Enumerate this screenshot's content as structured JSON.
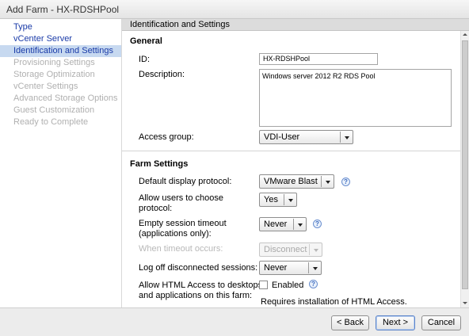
{
  "window": {
    "title": "Add Farm - HX-RDSHPool"
  },
  "sidebar": {
    "items": [
      {
        "label": "Type",
        "state": "done"
      },
      {
        "label": "vCenter Server",
        "state": "done"
      },
      {
        "label": "Identification and Settings",
        "state": "active"
      },
      {
        "label": "Provisioning Settings",
        "state": "disabled"
      },
      {
        "label": "Storage Optimization",
        "state": "disabled"
      },
      {
        "label": "vCenter Settings",
        "state": "disabled"
      },
      {
        "label": "Advanced Storage Options",
        "state": "disabled"
      },
      {
        "label": "Guest Customization",
        "state": "disabled"
      },
      {
        "label": "Ready to Complete",
        "state": "disabled"
      }
    ]
  },
  "main": {
    "header": "Identification and Settings",
    "general": {
      "title": "General",
      "id_label": "ID:",
      "id_value": "HX-RDSHPool",
      "description_label": "Description:",
      "description_value": "Windows server 2012 R2 RDS Pool",
      "access_group_label": "Access group:",
      "access_group_value": "VDI-User"
    },
    "farm_settings": {
      "title": "Farm Settings",
      "display_protocol_label": "Default display protocol:",
      "display_protocol_value": "VMware Blast",
      "allow_choose_label_1": "Allow users to choose",
      "allow_choose_label_2": "protocol:",
      "allow_choose_value": "Yes",
      "empty_timeout_label_1": "Empty session timeout",
      "empty_timeout_label_2": "(applications only):",
      "empty_timeout_value": "Never",
      "when_timeout_label": "When timeout occurs:",
      "when_timeout_value": "Disconnect",
      "logoff_label": "Log off disconnected sessions:",
      "logoff_value": "Never",
      "html_access_label_1": "Allow HTML Access to desktops",
      "html_access_label_2": "and applications on this farm:",
      "html_access_checkbox_label": "Enabled",
      "html_access_checked": false,
      "html_access_note": "Requires installation of HTML Access."
    }
  },
  "footer": {
    "back_label": "< Back",
    "next_label": "Next >",
    "cancel_label": "Cancel"
  },
  "icons": {
    "help": "?"
  },
  "colors": {
    "nav_active_bg": "#c7d9f0",
    "nav_link": "#1a3ba8",
    "nav_disabled": "#b0b0b0"
  }
}
